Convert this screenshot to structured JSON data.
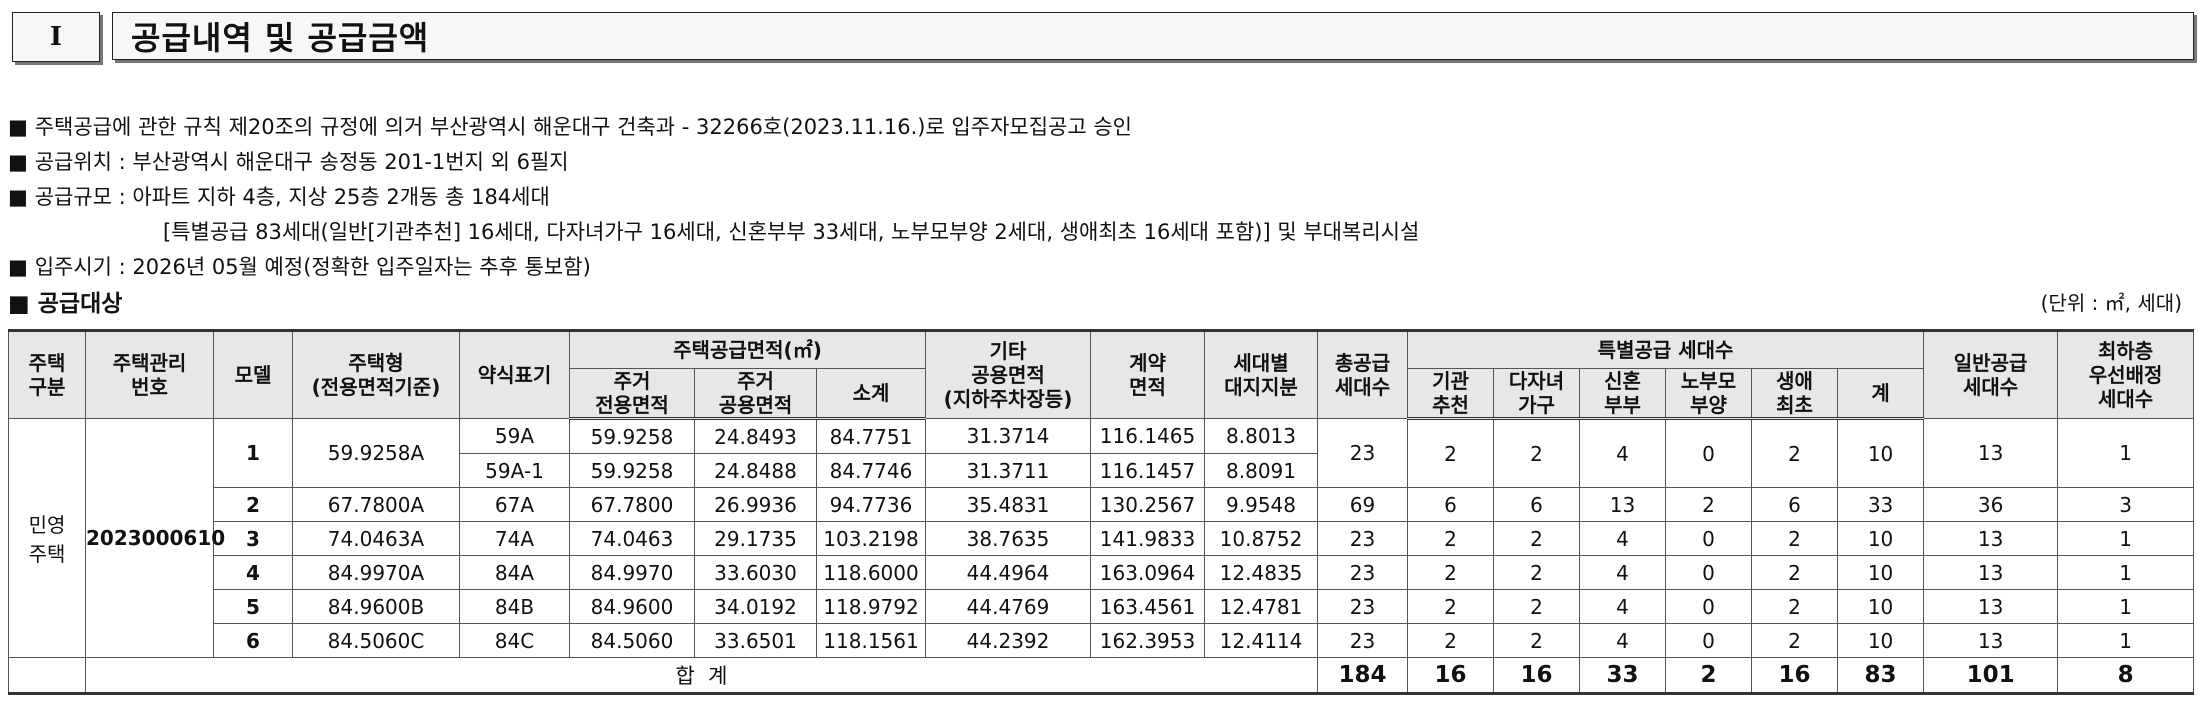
{
  "header": {
    "roman": "I",
    "title": "공급내역 및 공급금액"
  },
  "bullets": [
    {
      "mark": "■",
      "text": "주택공급에 관한 규칙 제20조의 규정에 의거 부산광역시 해운대구  건축과 - 32266호(2023.11.16.)로 입주자모집공고 승인"
    },
    {
      "mark": "■",
      "text": "공급위치 : 부산광역시 해운대구 송정동 201-1번지 외 6필지"
    },
    {
      "mark": "■",
      "text": "공급규모 : 아파트 지하 4층, 지상 25층 2개동 총 184세대"
    },
    {
      "mark": "",
      "text": "[특별공급 83세대(일반[기관추천] 16세대, 다자녀가구 16세대, 신혼부부 33세대, 노부모부양 2세대, 생애최초 16세대 포함)] 및 부대복리시설"
    },
    {
      "mark": "■",
      "text": "입주시기 : 2026년 05월 예정(정확한 입주일자는 추후 통보함)"
    }
  ],
  "section": {
    "mark": "■",
    "title": "공급대상",
    "unit": "(단위 : ㎡, 세대)"
  },
  "table": {
    "headers": {
      "house_type": "주택\n구분",
      "mgmt_no": "주택관리\n번호",
      "model": "모델",
      "housing_type": "주택형\n(전용면적기준)",
      "abbr": "약식표기",
      "supply_area": "주택공급면적(㎡)",
      "exclusive": "주거\n전용면적",
      "common": "주거\n공용면적",
      "subtotal": "소계",
      "other": "기타\n공용면적\n(지하주차장등)",
      "contract": "계약\n면적",
      "land": "세대별\n대지지분",
      "total": "총공급\n세대수",
      "special": "특별공급 세대수",
      "agency": "기관\n추천",
      "multichild": "다자녀\n가구",
      "newlywed": "신혼\n부부",
      "parents": "노부모\n부양",
      "firsttime": "생애\n최초",
      "special_sum": "계",
      "general": "일반공급\n세대수",
      "lowest": "최하층\n우선배정\n세대수"
    },
    "house_type_value": "민영\n주택",
    "mgmt_no_value": "2023000610",
    "models": [
      {
        "model": "1",
        "housing_type": "59.9258A",
        "rows": [
          {
            "abbr": "59A",
            "exclusive": "59.9258",
            "common": "24.8493",
            "subtotal": "84.7751",
            "other": "31.3714",
            "contract": "116.1465",
            "land": "8.8013"
          },
          {
            "abbr": "59A-1",
            "exclusive": "59.9258",
            "common": "24.8488",
            "subtotal": "84.7746",
            "other": "31.3711",
            "contract": "116.1457",
            "land": "8.8091"
          }
        ],
        "total": "23",
        "agency": "2",
        "multichild": "2",
        "newlywed": "4",
        "parents": "0",
        "firsttime": "2",
        "special_sum": "10",
        "general": "13",
        "lowest": "1"
      },
      {
        "model": "2",
        "housing_type": "67.7800A",
        "rows": [
          {
            "abbr": "67A",
            "exclusive": "67.7800",
            "common": "26.9936",
            "subtotal": "94.7736",
            "other": "35.4831",
            "contract": "130.2567",
            "land": "9.9548"
          }
        ],
        "total": "69",
        "agency": "6",
        "multichild": "6",
        "newlywed": "13",
        "parents": "2",
        "firsttime": "6",
        "special_sum": "33",
        "general": "36",
        "lowest": "3"
      },
      {
        "model": "3",
        "housing_type": "74.0463A",
        "rows": [
          {
            "abbr": "74A",
            "exclusive": "74.0463",
            "common": "29.1735",
            "subtotal": "103.2198",
            "other": "38.7635",
            "contract": "141.9833",
            "land": "10.8752"
          }
        ],
        "total": "23",
        "agency": "2",
        "multichild": "2",
        "newlywed": "4",
        "parents": "0",
        "firsttime": "2",
        "special_sum": "10",
        "general": "13",
        "lowest": "1"
      },
      {
        "model": "4",
        "housing_type": "84.9970A",
        "rows": [
          {
            "abbr": "84A",
            "exclusive": "84.9970",
            "common": "33.6030",
            "subtotal": "118.6000",
            "other": "44.4964",
            "contract": "163.0964",
            "land": "12.4835"
          }
        ],
        "total": "23",
        "agency": "2",
        "multichild": "2",
        "newlywed": "4",
        "parents": "0",
        "firsttime": "2",
        "special_sum": "10",
        "general": "13",
        "lowest": "1"
      },
      {
        "model": "5",
        "housing_type": "84.9600B",
        "rows": [
          {
            "abbr": "84B",
            "exclusive": "84.9600",
            "common": "34.0192",
            "subtotal": "118.9792",
            "other": "44.4769",
            "contract": "163.4561",
            "land": "12.4781"
          }
        ],
        "total": "23",
        "agency": "2",
        "multichild": "2",
        "newlywed": "4",
        "parents": "0",
        "firsttime": "2",
        "special_sum": "10",
        "general": "13",
        "lowest": "1"
      },
      {
        "model": "6",
        "housing_type": "84.5060C",
        "rows": [
          {
            "abbr": "84C",
            "exclusive": "84.5060",
            "common": "33.6501",
            "subtotal": "118.1561",
            "other": "44.2392",
            "contract": "162.3953",
            "land": "12.4114"
          }
        ],
        "total": "23",
        "agency": "2",
        "multichild": "2",
        "newlywed": "4",
        "parents": "0",
        "firsttime": "2",
        "special_sum": "10",
        "general": "13",
        "lowest": "1"
      }
    ],
    "totals": {
      "label": "합  계",
      "total": "184",
      "agency": "16",
      "multichild": "16",
      "newlywed": "33",
      "parents": "2",
      "firsttime": "16",
      "special_sum": "83",
      "general": "101",
      "lowest": "8"
    }
  }
}
